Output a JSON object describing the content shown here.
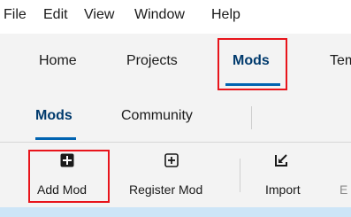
{
  "menu": {
    "file": "File",
    "edit": "Edit",
    "view": "View",
    "window": "Window",
    "help": "Help"
  },
  "nav": {
    "home": "Home",
    "projects": "Projects",
    "mods": "Mods",
    "templates_partial": "Tem",
    "active": "Mods"
  },
  "subnav": {
    "mods": "Mods",
    "community": "Community",
    "active": "Mods"
  },
  "toolbar": {
    "add_mod": "Add Mod",
    "register_mod": "Register Mod",
    "import": "Import",
    "export_partial": "E"
  },
  "icons": {
    "add_mod": "plus-square-filled-icon",
    "register_mod": "plus-square-outline-icon",
    "import": "import-icon",
    "export": "export-icon"
  },
  "colors": {
    "highlight_box": "#e8141b",
    "accent": "#0063b1",
    "active_text": "#003a6d",
    "list_header": "#cde5f7"
  }
}
